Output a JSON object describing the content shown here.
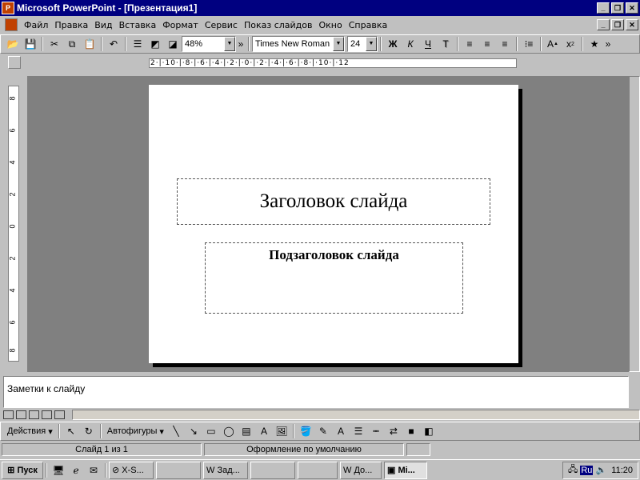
{
  "window": {
    "title": "Microsoft PowerPoint - [Презентация1]",
    "app_icon": "P"
  },
  "menu": [
    "Файл",
    "Правка",
    "Вид",
    "Вставка",
    "Формат",
    "Сервис",
    "Показ слайдов",
    "Окно",
    "Справка"
  ],
  "toolbar": {
    "zoom": "48%",
    "font": "Times New Roman",
    "size": "24",
    "bold": "Ж",
    "italic": "К",
    "underline": "Ч",
    "shadow": "Т",
    "font_grow": "A",
    "font_grow_sup": "▲",
    "font_shrink": "x",
    "font_shrink_sub": "2"
  },
  "ruler": {
    "horizontal": "2·|·10·|·8·|·6·|·4·|·2·|·0·|·2·|·4·|·6·|·8·|·10·|·12"
  },
  "slide": {
    "title": "Заголовок слайда",
    "subtitle": "Подзаголовок слайда"
  },
  "notes": {
    "placeholder": "Заметки к слайду"
  },
  "drawing": {
    "actions": "Действия",
    "autoshapes": "Автофигуры"
  },
  "status": {
    "slide": "Слайд 1 из 1",
    "design": "Оформление по умолчанию"
  },
  "taskbar": {
    "start": "Пуск",
    "tasks": [
      "X-S...",
      "",
      "Зад...",
      "",
      "",
      "До...",
      "Mi..."
    ],
    "lang": "Ru",
    "time": "11:20"
  }
}
